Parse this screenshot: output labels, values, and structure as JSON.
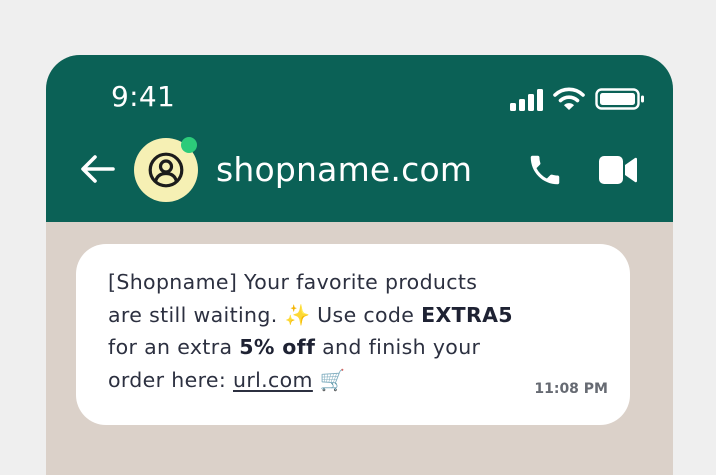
{
  "status_bar": {
    "time": "9:41",
    "icons": [
      "cellular-signal-icon",
      "wifi-icon",
      "battery-icon"
    ]
  },
  "chat_header": {
    "back_icon": "arrow-left-icon",
    "avatar_icon": "user-circle-icon",
    "online_status_color": "#2ccb7a",
    "contact_name": "shopname.com",
    "call_icon": "phone-icon",
    "video_icon": "video-camera-icon"
  },
  "message": {
    "line1": "[Shopname] Your favorite products",
    "line2_pre": "are still waiting. ",
    "sparkle_emoji": "✨",
    "line2_mid": " Use code ",
    "code": "EXTRA5",
    "line3_pre": "for an extra ",
    "discount": "5% off",
    "line3_post": " and finish your",
    "line4_pre": "order here: ",
    "link": "url.com",
    "cart_emoji": "🛒",
    "time": "11:08 PM"
  },
  "colors": {
    "header_bg": "#0b6156",
    "chat_bg": "#dbd1c9",
    "avatar_bg": "#f6f0b4",
    "online_dot": "#2ccb7a"
  }
}
